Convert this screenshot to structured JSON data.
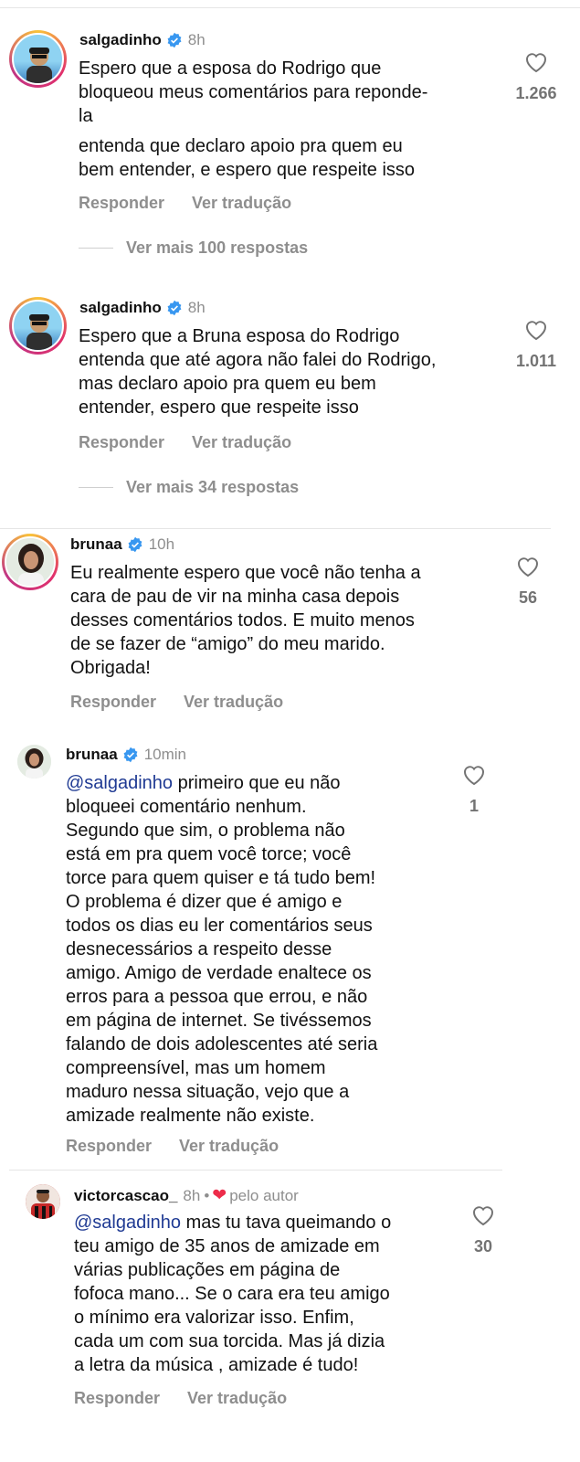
{
  "comments": [
    {
      "username": "salgadinho",
      "time": "8h",
      "lines": [
        "Espero que a esposa do Rodrigo que",
        "bloqueou meus comentários para reponde-",
        "la"
      ],
      "lines2": [
        "entenda que declaro apoio pra quem eu",
        "bem entender, e espero que respeite isso"
      ],
      "likes": "1.266",
      "reply": "Responder",
      "translate": "Ver tradução",
      "more_replies": "Ver mais 100 respostas"
    },
    {
      "username": "salgadinho",
      "time": "8h",
      "lines": [
        "Espero que a Bruna esposa do Rodrigo",
        "entenda que até agora não falei do Rodrigo,",
        "mas declaro apoio pra quem eu bem",
        "entender, espero que respeite isso"
      ],
      "likes": "1.011",
      "reply": "Responder",
      "translate": "Ver tradução",
      "more_replies": "Ver mais 34 respostas"
    },
    {
      "username": "brunaa",
      "time": "10h",
      "lines": [
        "Eu realmente espero que você não tenha a",
        "cara de pau de vir na minha casa depois",
        "desses comentários todos. E muito menos",
        "de se fazer de “amigo” do meu marido.",
        "Obrigada!"
      ],
      "likes": "56",
      "reply": "Responder",
      "translate": "Ver tradução"
    },
    {
      "username": "brunaa",
      "time": "10min",
      "mention": "@salgadinho",
      "first_line_rest": " primeiro que eu não",
      "lines": [
        "bloqueei comentário nenhum.",
        "Segundo que sim, o problema não",
        "está em pra quem você torce; você",
        "torce para quem quiser e tá tudo bem!",
        "O problema é dizer que é amigo e",
        "todos os dias eu ler comentários seus",
        "desnecessários a respeito desse",
        "amigo. Amigo de verdade enaltece os",
        "erros para a pessoa que errou, e não",
        "em página de internet. Se tivéssemos",
        "falando de dois adolescentes até seria",
        "compreensível, mas um homem",
        "maduro nessa situação, vejo que a",
        "amizade realmente não existe."
      ],
      "likes": "1",
      "reply": "Responder",
      "translate": "Ver tradução"
    },
    {
      "username": "victorcascao_",
      "time": "8h",
      "separator": "•",
      "author_label": "pelo autor",
      "mention": "@salgadinho",
      "first_line_rest": " mas tu tava queimando o",
      "lines": [
        "teu amigo de 35 anos de amizade em",
        "várias publicações em página de",
        "fofoca mano... Se o cara era teu amigo",
        "o mínimo era valorizar isso. Enfim,",
        "cada um com sua torcida. Mas já dizia",
        "a letra da música , amizade é tudo!"
      ],
      "likes": "30",
      "reply": "Responder",
      "translate": "Ver tradução"
    }
  ],
  "colors": {
    "verified": "#3897f0",
    "like_heart_red": "#ed2c4a",
    "muted": "#8e8e8e",
    "mention": "#1f3a93"
  }
}
